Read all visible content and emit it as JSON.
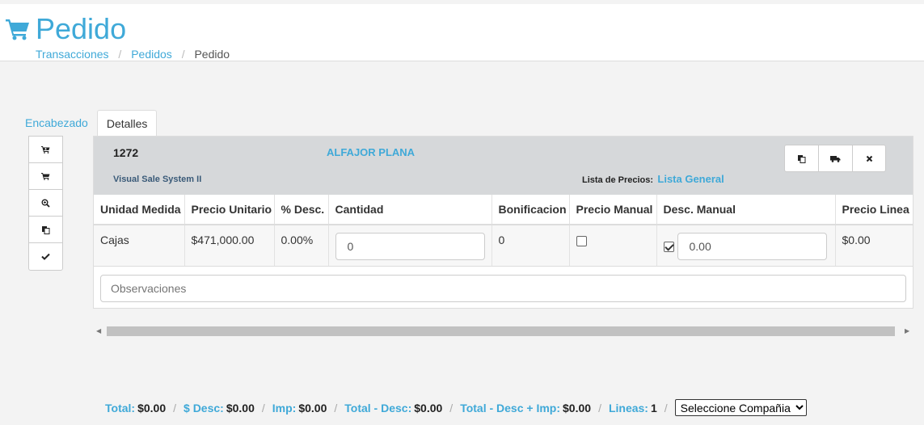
{
  "header": {
    "title": "Pedido",
    "breadcrumb": [
      "Transacciones",
      "Pedidos",
      "Pedido"
    ]
  },
  "tabs": [
    "Encabezado",
    "Detalles"
  ],
  "active_tab": "Detalles",
  "sidebar_icons": [
    "cart-arrow-icon",
    "cart-icon",
    "zoom-icon",
    "copy-icon",
    "check-icon"
  ],
  "product": {
    "code": "1272",
    "name": "ALFAJOR PLANA",
    "company": "Visual Sale System II",
    "price_list_label": "Lista de Precios:",
    "price_list_value": "Lista General"
  },
  "action_icons": [
    "copy-icon",
    "truck-icon",
    "close-icon"
  ],
  "table": {
    "columns": [
      "Unidad Medida",
      "Precio Unitario",
      "% Desc.",
      "Cantidad",
      "Bonificacion",
      "Precio Manual",
      "Desc. Manual",
      "Precio Linea"
    ],
    "row": {
      "unidad": "Cajas",
      "precio_unitario": "$471,000.00",
      "desc_pct": "0.00%",
      "cantidad": "0",
      "bonificacion": "0",
      "precio_manual_checked": false,
      "desc_manual_checked": true,
      "desc_manual_value": "0.00",
      "precio_linea": "$0.00"
    }
  },
  "observaciones_placeholder": "Observaciones",
  "footer": {
    "total_label": "Total:",
    "total": "$0.00",
    "desc_label": "$ Desc:",
    "desc": "$0.00",
    "imp_label": "Imp:",
    "imp": "$0.00",
    "total_desc_label": "Total - Desc:",
    "total_desc": "$0.00",
    "total_desc_imp_label": "Total - Desc + Imp:",
    "total_desc_imp": "$0.00",
    "lineas_label": "Lineas:",
    "lineas": "1",
    "company_select": "Seleccione Compañia"
  },
  "colors": {
    "accent": "#3fa9d8",
    "header_bg": "#d6d8da"
  }
}
